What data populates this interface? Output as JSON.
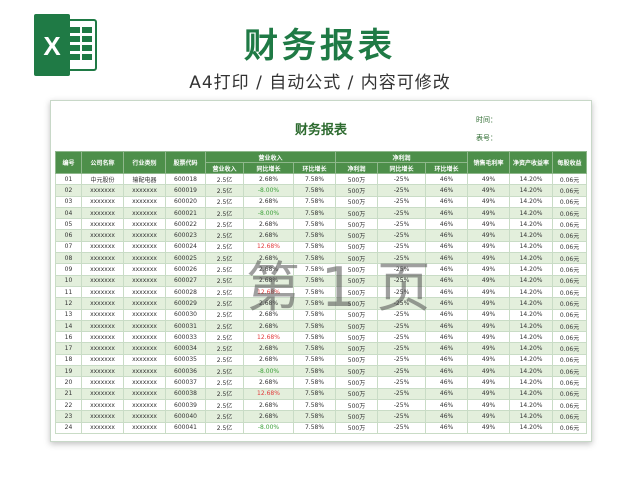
{
  "banner": {
    "title": "财务报表",
    "subtitle": "A4打印 / 自动公式 / 内容可修改",
    "logo_letter": "X"
  },
  "sheet": {
    "title": "财务报表",
    "time_label": "时间：",
    "number_label": "表号：",
    "watermark": "第 1 页"
  },
  "colors": {
    "brand_green": "#1f7a45",
    "header_green": "#4d8f4a",
    "row_alt": "#e3efdc",
    "negative_green": "#3da03a",
    "negative_red": "#e23b3b"
  },
  "table": {
    "headers_top": [
      "编号",
      "公司名称",
      "行业类别",
      "股票代码",
      "营业收入",
      "净利润",
      "销售毛利率",
      "净资产收益率",
      "每股收益"
    ],
    "headers_sub": [
      "营业收入",
      "同比增长",
      "环比增长",
      "净利润",
      "同比增长",
      "环比增长"
    ],
    "rows": [
      [
        "01",
        "中元股份",
        "输配电器",
        "600018",
        "2.5亿",
        "2.68%",
        "7.58%",
        "500万",
        "-25%",
        "46%",
        "49%",
        "14.20%",
        "0.06元"
      ],
      [
        "02",
        "xxxxxxx",
        "xxxxxxx",
        "600019",
        "2.5亿",
        "-8.00%",
        "7.58%",
        "500万",
        "-25%",
        "46%",
        "49%",
        "14.20%",
        "0.06元"
      ],
      [
        "03",
        "xxxxxxx",
        "xxxxxxx",
        "600020",
        "2.5亿",
        "2.68%",
        "7.58%",
        "500万",
        "-25%",
        "46%",
        "49%",
        "14.20%",
        "0.06元"
      ],
      [
        "04",
        "xxxxxxx",
        "xxxxxxx",
        "600021",
        "2.5亿",
        "-8.00%",
        "7.58%",
        "500万",
        "-25%",
        "46%",
        "49%",
        "14.20%",
        "0.06元"
      ],
      [
        "05",
        "xxxxxxx",
        "xxxxxxx",
        "600022",
        "2.5亿",
        "2.68%",
        "7.58%",
        "500万",
        "-25%",
        "46%",
        "49%",
        "14.20%",
        "0.06元"
      ],
      [
        "06",
        "xxxxxxx",
        "xxxxxxx",
        "600023",
        "2.5亿",
        "2.68%",
        "7.58%",
        "500万",
        "-25%",
        "46%",
        "49%",
        "14.20%",
        "0.06元"
      ],
      [
        "07",
        "xxxxxxx",
        "xxxxxxx",
        "600024",
        "2.5亿",
        "12.68%",
        "7.58%",
        "500万",
        "-25%",
        "46%",
        "49%",
        "14.20%",
        "0.06元"
      ],
      [
        "08",
        "xxxxxxx",
        "xxxxxxx",
        "600025",
        "2.5亿",
        "2.68%",
        "7.58%",
        "500万",
        "-25%",
        "46%",
        "49%",
        "14.20%",
        "0.06元"
      ],
      [
        "09",
        "xxxxxxx",
        "xxxxxxx",
        "600026",
        "2.5亿",
        "2.68%",
        "7.58%",
        "500万",
        "-25%",
        "46%",
        "49%",
        "14.20%",
        "0.06元"
      ],
      [
        "10",
        "xxxxxxx",
        "xxxxxxx",
        "600027",
        "2.5亿",
        "2.68%",
        "7.58%",
        "500万",
        "-25%",
        "46%",
        "49%",
        "14.20%",
        "0.06元"
      ],
      [
        "11",
        "xxxxxxx",
        "xxxxxxx",
        "600028",
        "2.5亿",
        "12.68%",
        "7.58%",
        "500万",
        "-25%",
        "46%",
        "49%",
        "14.20%",
        "0.06元"
      ],
      [
        "12",
        "xxxxxxx",
        "xxxxxxx",
        "600029",
        "2.5亿",
        "2.68%",
        "7.58%",
        "500万",
        "-25%",
        "46%",
        "49%",
        "14.20%",
        "0.06元"
      ],
      [
        "13",
        "xxxxxxx",
        "xxxxxxx",
        "600030",
        "2.5亿",
        "2.68%",
        "7.58%",
        "500万",
        "-25%",
        "46%",
        "49%",
        "14.20%",
        "0.06元"
      ],
      [
        "14",
        "xxxxxxx",
        "xxxxxxx",
        "600031",
        "2.5亿",
        "2.68%",
        "7.58%",
        "500万",
        "-25%",
        "46%",
        "49%",
        "14.20%",
        "0.06元"
      ],
      [
        "16",
        "xxxxxxx",
        "xxxxxxx",
        "600033",
        "2.5亿",
        "12.68%",
        "7.58%",
        "500万",
        "-25%",
        "46%",
        "49%",
        "14.20%",
        "0.06元"
      ],
      [
        "17",
        "xxxxxxx",
        "xxxxxxx",
        "600034",
        "2.5亿",
        "2.68%",
        "7.58%",
        "500万",
        "-25%",
        "46%",
        "49%",
        "14.20%",
        "0.06元"
      ],
      [
        "18",
        "xxxxxxx",
        "xxxxxxx",
        "600035",
        "2.5亿",
        "2.68%",
        "7.58%",
        "500万",
        "-25%",
        "46%",
        "49%",
        "14.20%",
        "0.06元"
      ],
      [
        "19",
        "xxxxxxx",
        "xxxxxxx",
        "600036",
        "2.5亿",
        "-8.00%",
        "7.58%",
        "500万",
        "-25%",
        "46%",
        "49%",
        "14.20%",
        "0.06元"
      ],
      [
        "20",
        "xxxxxxx",
        "xxxxxxx",
        "600037",
        "2.5亿",
        "2.68%",
        "7.58%",
        "500万",
        "-25%",
        "46%",
        "49%",
        "14.20%",
        "0.06元"
      ],
      [
        "21",
        "xxxxxxx",
        "xxxxxxx",
        "600038",
        "2.5亿",
        "12.68%",
        "7.58%",
        "500万",
        "-25%",
        "46%",
        "49%",
        "14.20%",
        "0.06元"
      ],
      [
        "22",
        "xxxxxxx",
        "xxxxxxx",
        "600039",
        "2.5亿",
        "2.68%",
        "7.58%",
        "500万",
        "-25%",
        "46%",
        "49%",
        "14.20%",
        "0.06元"
      ],
      [
        "23",
        "xxxxxxx",
        "xxxxxxx",
        "600040",
        "2.5亿",
        "2.68%",
        "7.58%",
        "500万",
        "-25%",
        "46%",
        "49%",
        "14.20%",
        "0.06元"
      ],
      [
        "24",
        "xxxxxxx",
        "xxxxxxx",
        "600041",
        "2.5亿",
        "-8.00%",
        "7.58%",
        "500万",
        "-25%",
        "46%",
        "49%",
        "14.20%",
        "0.06元"
      ]
    ]
  }
}
